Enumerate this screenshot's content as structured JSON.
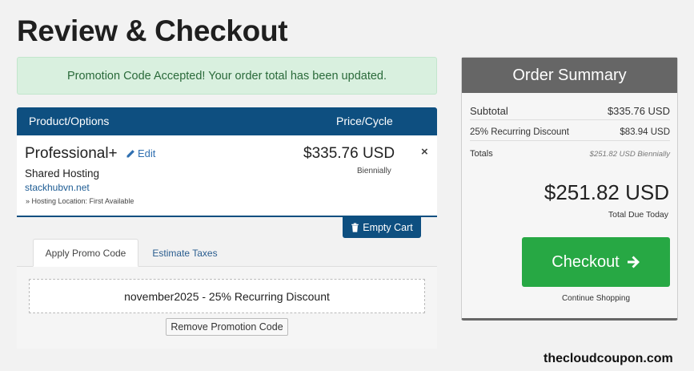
{
  "page": {
    "title": "Review & Checkout"
  },
  "alert": {
    "text": "Promotion Code Accepted! Your order total has been updated.",
    "color": "#d9f0df"
  },
  "cart": {
    "header": {
      "product_col": "Product/Options",
      "price_col": "Price/Cycle",
      "color": "#0e4f80"
    },
    "item": {
      "name": "Professional+",
      "edit_label": "Edit",
      "group": "Shared Hosting",
      "domain": "stackhubvn.net",
      "config": "» Hosting Location: First Available",
      "price": "$335.76 USD",
      "cycle": "Biennially",
      "remove_icon": "×"
    },
    "empty_cart_label": "Empty Cart"
  },
  "tabs": [
    {
      "label": "Apply Promo Code",
      "active": true
    },
    {
      "label": "Estimate Taxes",
      "active": false
    }
  ],
  "promo": {
    "applied": "november2025 - 25% Recurring Discount",
    "remove_label": "Remove Promotion Code"
  },
  "summary": {
    "title": "Order Summary",
    "subtotal_label": "Subtotal",
    "subtotal_value": "$335.76 USD",
    "discount_label": "25% Recurring Discount",
    "discount_value": "$83.94 USD",
    "totals_label": "Totals",
    "totals_value": "$251.82 USD Biennially",
    "total_amount": "$251.82 USD",
    "total_due_label": "Total Due Today",
    "checkout_label": "Checkout",
    "checkout_color": "#27a844",
    "continue_label": "Continue Shopping"
  },
  "watermark": "thecloudcoupon.com",
  "icons": {
    "edit": "pencil-icon",
    "empty_cart": "trash-icon",
    "checkout": "arrow-right-icon",
    "remove": "close-icon"
  }
}
